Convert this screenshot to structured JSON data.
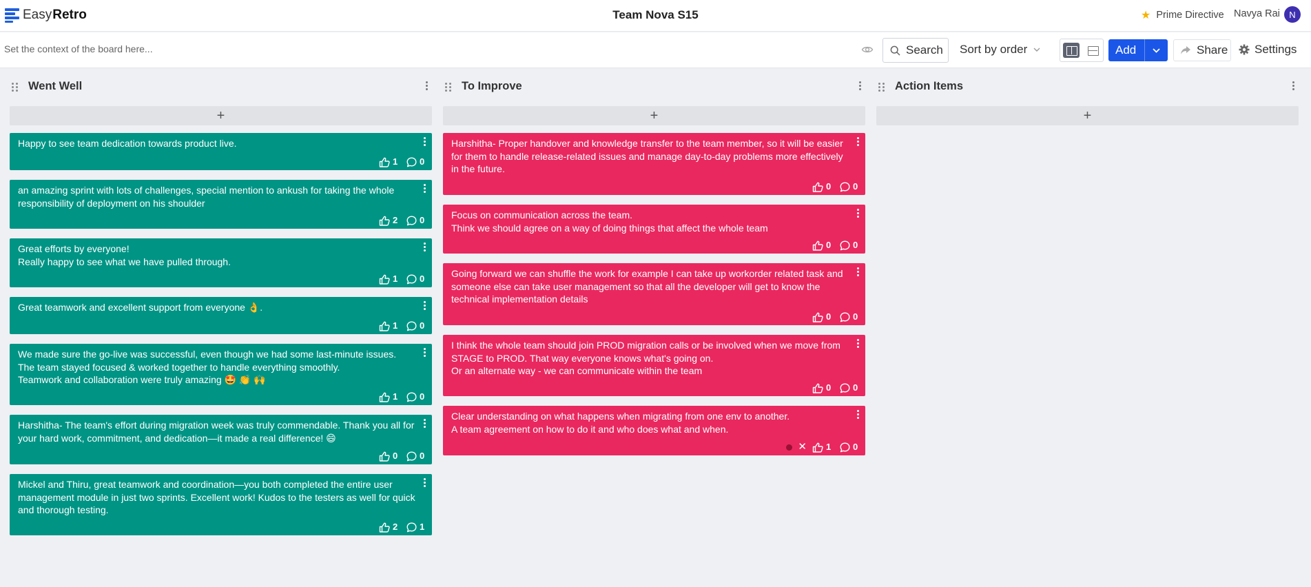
{
  "app": {
    "logo_easy": "Easy",
    "logo_retro": "Retro",
    "board_title": "Team Nova S15",
    "prime_directive": "Prime Directive",
    "user_name": "Navya Rai",
    "user_initial": "N"
  },
  "toolbar": {
    "context_placeholder": "Set the context of the board here...",
    "search_label": "Search",
    "sort_label": "Sort by order",
    "add_label": "Add",
    "share_label": "Share",
    "settings_label": "Settings"
  },
  "colors": {
    "went_well": "#009485",
    "to_improve": "#e9285f",
    "accent": "#1a56e8"
  },
  "columns": [
    {
      "title": "Went Well",
      "add_symbol": "+",
      "cards": [
        {
          "text": "Happy to see team dedication towards product live.",
          "votes": "1",
          "comments": "0"
        },
        {
          "text": "an amazing sprint with lots of challenges, special mention to ankush for taking the whole responsibility of deployment on his shoulder",
          "votes": "2",
          "comments": "0"
        },
        {
          "text": "Great efforts by everyone!\nReally happy to see what we have pulled through.",
          "votes": "1",
          "comments": "0"
        },
        {
          "text": "Great teamwork and excellent support from everyone 👌.",
          "votes": "1",
          "comments": "0"
        },
        {
          "text": "We made sure the go-live was successful, even though we had some last-minute issues.\nThe team stayed focused & worked together to handle everything smoothly.\nTeamwork and collaboration were truly amazing 🤩 👏 🙌",
          "votes": "1",
          "comments": "0"
        },
        {
          "text": "Harshitha- The team's effort during migration week was truly commendable. Thank you all for your hard work, commitment, and dedication—it made a real difference! 😄",
          "votes": "0",
          "comments": "0"
        },
        {
          "text": "Mickel and Thiru, great teamwork and coordination—you both completed the entire user management module in just two sprints. Excellent work! Kudos to the testers as well for quick and thorough testing.",
          "votes": "2",
          "comments": "1"
        }
      ]
    },
    {
      "title": "To Improve",
      "add_symbol": "+",
      "cards": [
        {
          "text": "Harshitha- Proper handover and knowledge transfer to the team member, so it will be easier for them to handle release-related issues and manage day-to-day problems more effectively in the future.",
          "votes": "0",
          "comments": "0"
        },
        {
          "text": "Focus on communication across the team.\nThink we should agree on a way of doing things that affect the whole team",
          "votes": "0",
          "comments": "0"
        },
        {
          "text": "Going forward we can shuffle the work for example I can take up workorder related task and someone else can take user management so that all the developer will get to know the technical implementation details",
          "votes": "0",
          "comments": "0"
        },
        {
          "text": "I think the whole team should join PROD migration calls or be involved when we move from STAGE to PROD. That way everyone knows what's going on.\nOr an alternate way - we can communicate within the team",
          "votes": "0",
          "comments": "0"
        },
        {
          "text": "Clear understanding on what happens when migrating from one env to another.\nA team agreement on how to do it and who does what and when.",
          "votes": "1",
          "comments": "0",
          "extra_x": "✕"
        }
      ]
    },
    {
      "title": "Action Items",
      "add_symbol": "+",
      "cards": []
    }
  ]
}
